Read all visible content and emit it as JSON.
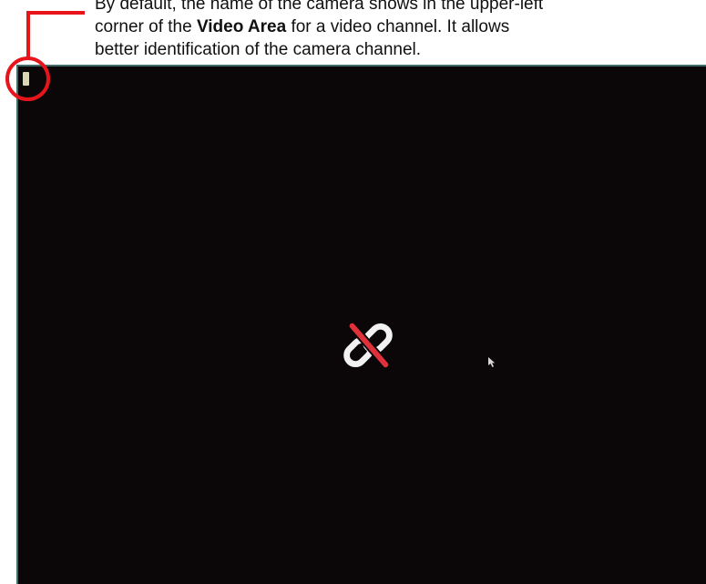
{
  "callout": {
    "line1": "By default, the name of the camera shows in the upper-left",
    "line2_prefix": "corner of the ",
    "line2_bold": "Video Area",
    "line2_suffix": " for a video channel. It allows",
    "line3": "better identification of the camera channel."
  },
  "video_area": {
    "status_icon": "broken-link-icon",
    "camera_name_label": "",
    "colors": {
      "background": "#0b0708",
      "border": "#3f6b6a",
      "label": "#d9d6b4",
      "icon_link": "#f2f2f2",
      "icon_slash": "#e0313a"
    }
  },
  "annotation": {
    "color": "#e8141c"
  }
}
